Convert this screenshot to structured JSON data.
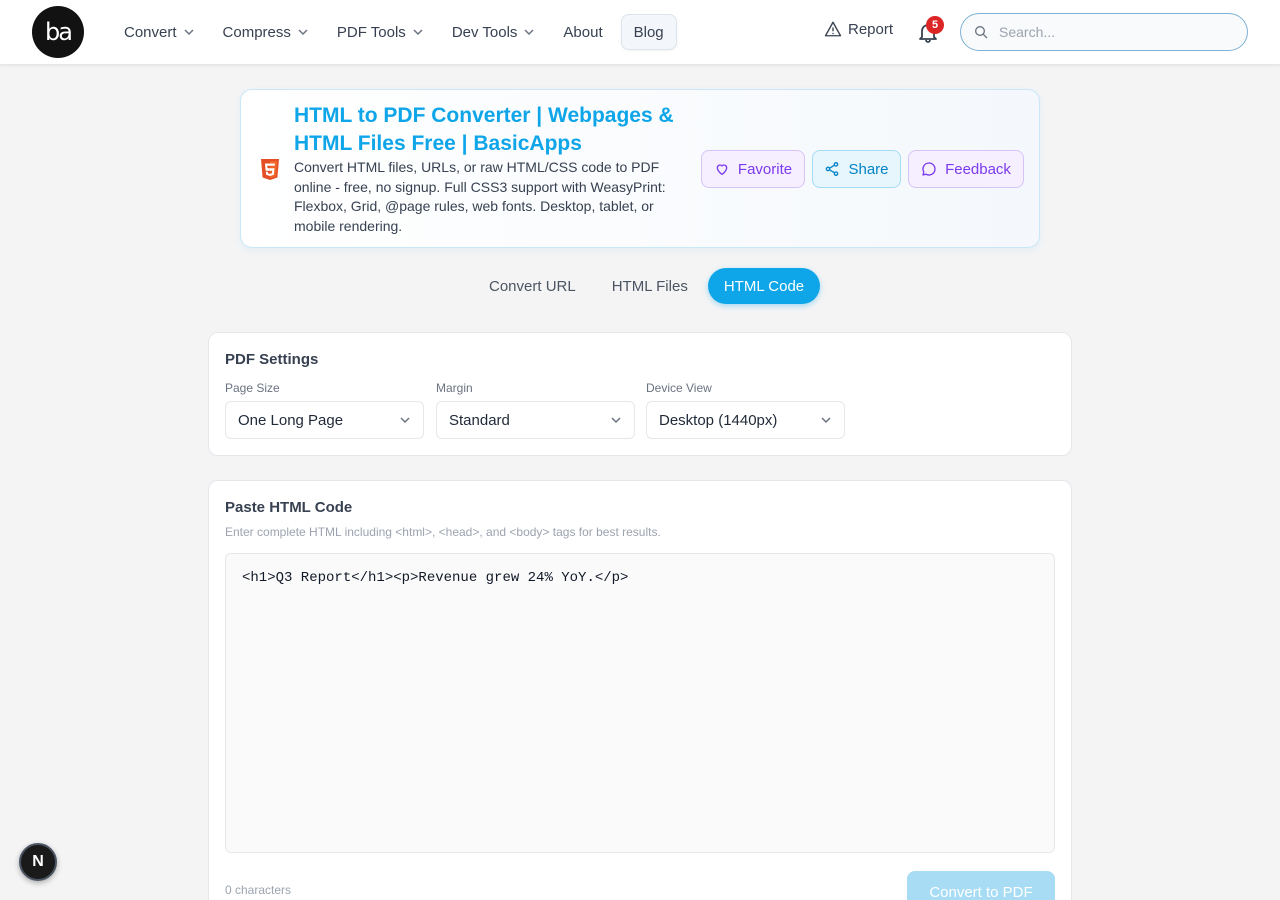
{
  "header": {
    "logo_text": "ba",
    "nav": [
      {
        "label": "Convert",
        "has_dropdown": true
      },
      {
        "label": "Compress",
        "has_dropdown": true
      },
      {
        "label": "PDF Tools",
        "has_dropdown": true
      },
      {
        "label": "Dev Tools",
        "has_dropdown": true
      },
      {
        "label": "About",
        "has_dropdown": false
      },
      {
        "label": "Blog",
        "has_dropdown": false
      }
    ],
    "report_label": "Report",
    "notification_count": "5",
    "search_placeholder": "Search..."
  },
  "hero": {
    "icon": "html5-icon",
    "title": "HTML to PDF Converter | Webpages & HTML Files Free | BasicApps",
    "description": "Convert HTML files, URLs, or raw HTML/CSS code to PDF online - free, no signup. Full CSS3 support with WeasyPrint: Flexbox, Grid, @page rules, web fonts. Desktop, tablet, or mobile rendering.",
    "favorite_label": "Favorite",
    "share_label": "Share",
    "feedback_label": "Feedback"
  },
  "tabs": [
    {
      "label": "Convert URL",
      "active": false
    },
    {
      "label": "HTML Files",
      "active": false
    },
    {
      "label": "HTML Code",
      "active": true
    }
  ],
  "settings": {
    "title": "PDF Settings",
    "page_size": {
      "label": "Page Size",
      "value": "One Long Page"
    },
    "margin": {
      "label": "Margin",
      "value": "Standard"
    },
    "device_view": {
      "label": "Device View",
      "value": "Desktop (1440px)"
    }
  },
  "code": {
    "title": "Paste HTML Code",
    "hint": "Enter complete HTML including <html>, <head>, and <body> tags for best results.",
    "value": "<h1>Q3 Report</h1><p>Revenue grew 24% YoY.</p>",
    "char_count": "0 characters",
    "convert_label": "Convert to PDF"
  },
  "dev_badge": "N",
  "colors": {
    "accent": "#0ea5e9",
    "badge_red": "#dc2626",
    "purple": "#7c3aed",
    "convert_disabled": "#a7dcf4"
  }
}
